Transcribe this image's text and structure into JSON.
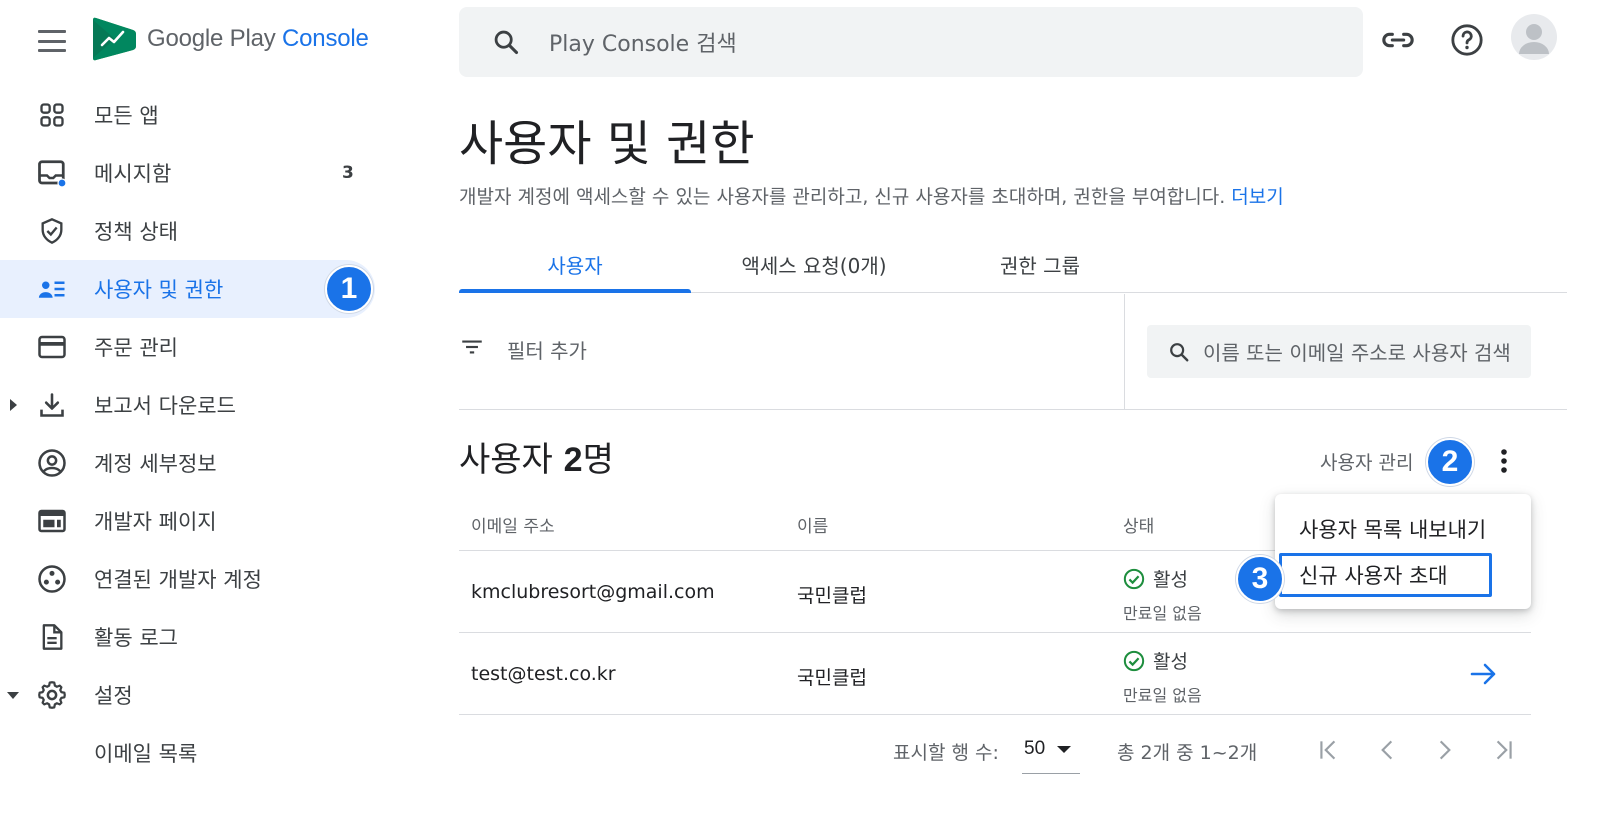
{
  "header": {
    "logo": {
      "text_google": "Google Play",
      "text_console": "Console"
    },
    "search_placeholder": "Play Console 검색",
    "icons": [
      "menu-icon",
      "link-icon",
      "help-icon",
      "account-avatar"
    ]
  },
  "sidebar": {
    "items": [
      {
        "label": "모든 앱",
        "icon": "apps-grid-icon"
      },
      {
        "label": "메시지함",
        "icon": "inbox-icon",
        "count": "3"
      },
      {
        "label": "정책 상태",
        "icon": "shield-check-icon"
      },
      {
        "label": "사용자 및 권한",
        "icon": "users-list-icon",
        "active": true
      },
      {
        "label": "주문 관리",
        "icon": "credit-card-icon"
      },
      {
        "label": "보고서 다운로드",
        "icon": "download-icon",
        "expandable": "collapsed"
      },
      {
        "label": "계정 세부정보",
        "icon": "account-circle-icon"
      },
      {
        "label": "개발자 페이지",
        "icon": "web-page-icon"
      },
      {
        "label": "연결된 개발자 계정",
        "icon": "linked-accounts-icon"
      },
      {
        "label": "활동 로그",
        "icon": "document-icon"
      },
      {
        "label": "설정",
        "icon": "gear-icon",
        "expandable": "expanded"
      },
      {
        "label": "이메일 목록",
        "sub": true
      }
    ]
  },
  "annotations": {
    "step1": "1",
    "step2": "2",
    "step3": "3"
  },
  "page": {
    "title": "사용자 및 권한",
    "description": "개발자 계정에 액세스할 수 있는 사용자를 관리하고, 신규 사용자를 초대하며, 권한을 부여합니다.",
    "learn_more": "더보기"
  },
  "tabs": [
    {
      "label": "사용자",
      "active": true
    },
    {
      "label": "액세스 요청(0개)"
    },
    {
      "label": "권한 그룹"
    }
  ],
  "filter": {
    "add_filter": "필터 추가",
    "search_placeholder": "이름 또는 이메일 주소로 사용자 검색"
  },
  "users": {
    "title_prefix": "사용자",
    "count": "2",
    "title_suffix": "명",
    "manage_label": "사용자 관리",
    "columns": [
      "이메일 주소",
      "이름",
      "상태"
    ],
    "rows": [
      {
        "email": "kmclubresort@gmail.com",
        "name": "국민클럽",
        "status": "활성",
        "expiry": "만료일 없음"
      },
      {
        "email": "test@test.co.kr",
        "name": "국민클럽",
        "status": "활성",
        "expiry": "만료일 없음"
      }
    ]
  },
  "menu": {
    "items": [
      "사용자 목록 내보내기",
      "신규 사용자 초대"
    ]
  },
  "pagination": {
    "rows_label": "표시할 행 수:",
    "rows_value": "50",
    "range": "총 2개 중 1~2개"
  },
  "colors": {
    "accent": "#1a73e8",
    "active_bg": "#e8f0fe",
    "status_green": "#1e8e3e",
    "text_secondary": "#5f6368"
  }
}
